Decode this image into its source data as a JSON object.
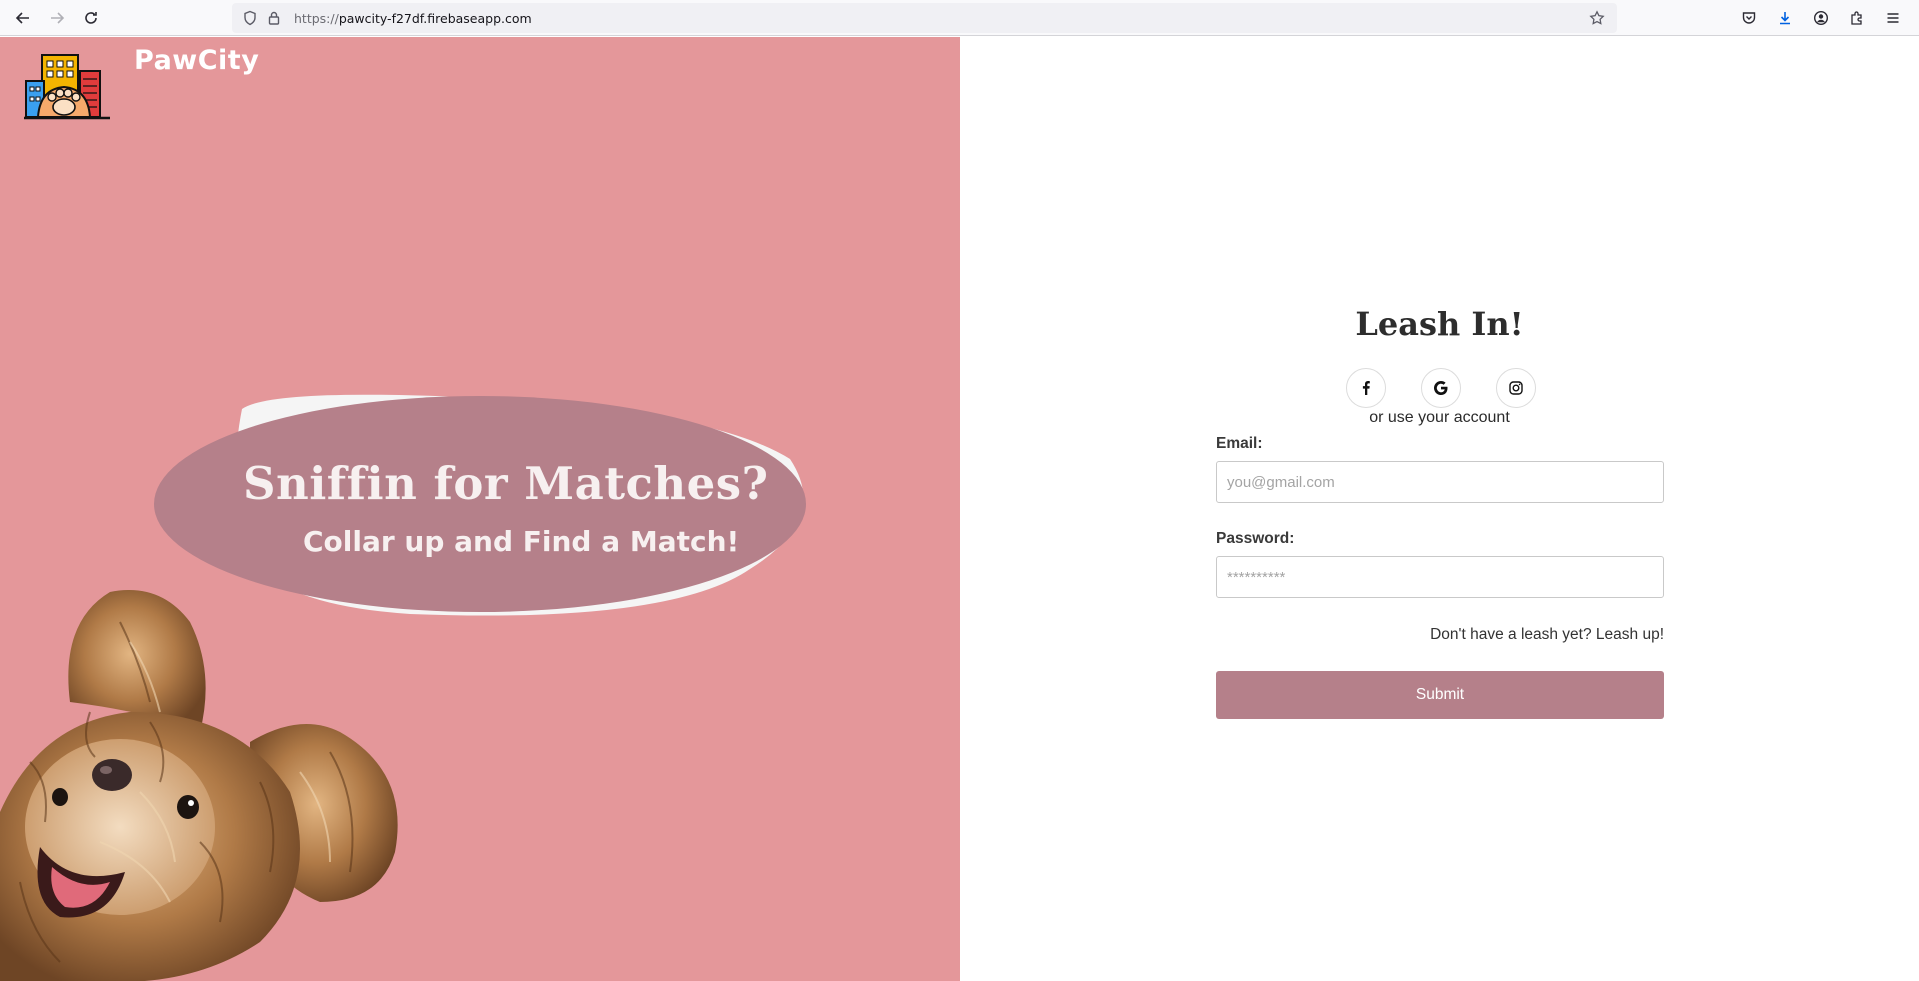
{
  "browser": {
    "url_scheme": "https://",
    "url_host": "pawcity-f27df.firebaseapp.com"
  },
  "hero": {
    "brand": "PawCity",
    "headline": "Sniffin for Matches?",
    "subline": "Collar up and Find a Match!",
    "background_color": "#e4979a",
    "blob_color": "#b5808a"
  },
  "login": {
    "title": "Leash In!",
    "alt_text": "or use your account",
    "social_icons": [
      "facebook-icon",
      "google-icon",
      "instagram-icon"
    ],
    "email_label": "Email:",
    "email_placeholder": "you@gmail.com",
    "password_label": "Password:",
    "password_placeholder": "**********",
    "signup_text": "Don't have a leash yet? Leash up!",
    "submit_label": "Submit",
    "accent_color": "#b5808a"
  }
}
